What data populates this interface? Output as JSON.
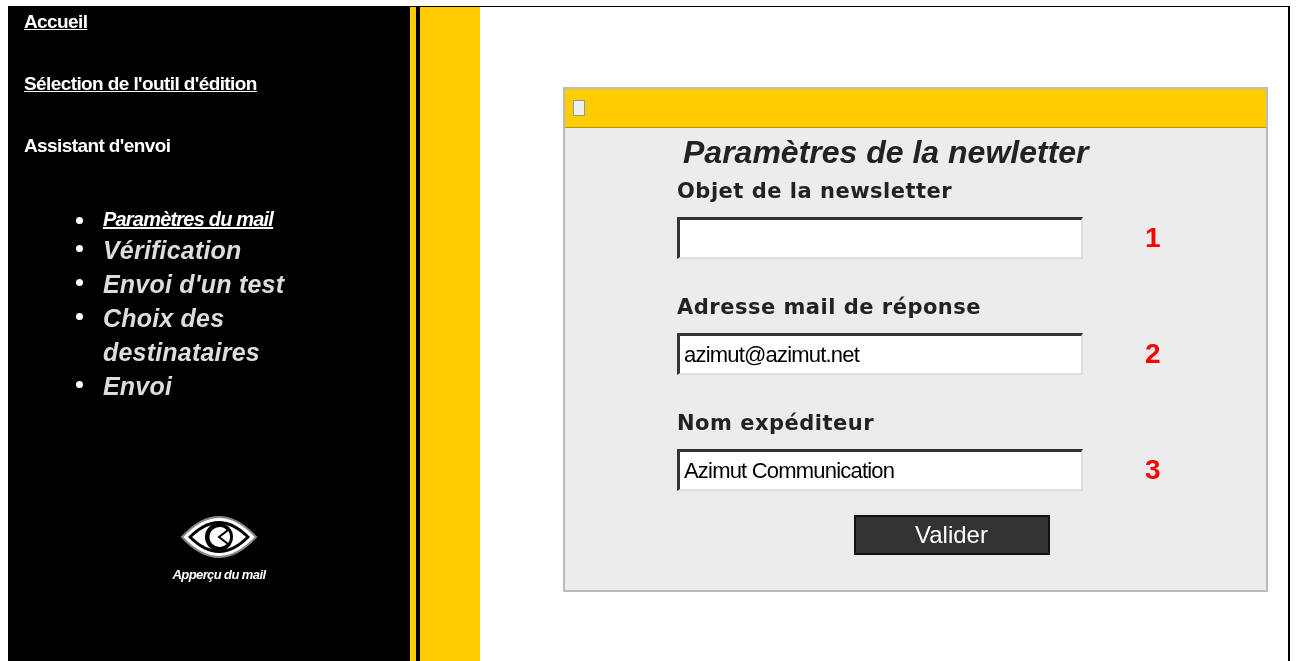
{
  "sidebar": {
    "links": [
      {
        "label": "Accueil"
      },
      {
        "label": "Sélection de l'outil d'édition"
      }
    ],
    "section_title": "Assistant d'envoi",
    "steps": [
      {
        "label": "Paramètres du mail",
        "selected": true
      },
      {
        "label": "Vérification",
        "selected": false
      },
      {
        "label": "Envoi d'un test",
        "selected": false
      },
      {
        "label": "Choix des destinataires",
        "selected": false
      },
      {
        "label": "Envoi",
        "selected": false
      }
    ],
    "preview": {
      "label": "Apperçu du mail"
    }
  },
  "dialog": {
    "title": "Paramètres de la newletter",
    "fields": [
      {
        "label": "Objet de la newsletter",
        "number": "1"
      },
      {
        "label": "Adresse mail de réponse",
        "value": "azimut@azimut.net",
        "number": "2"
      },
      {
        "label": "Nom expéditeur",
        "value": "Azimut Communication",
        "number": "3"
      }
    ],
    "button": "Valider"
  }
}
